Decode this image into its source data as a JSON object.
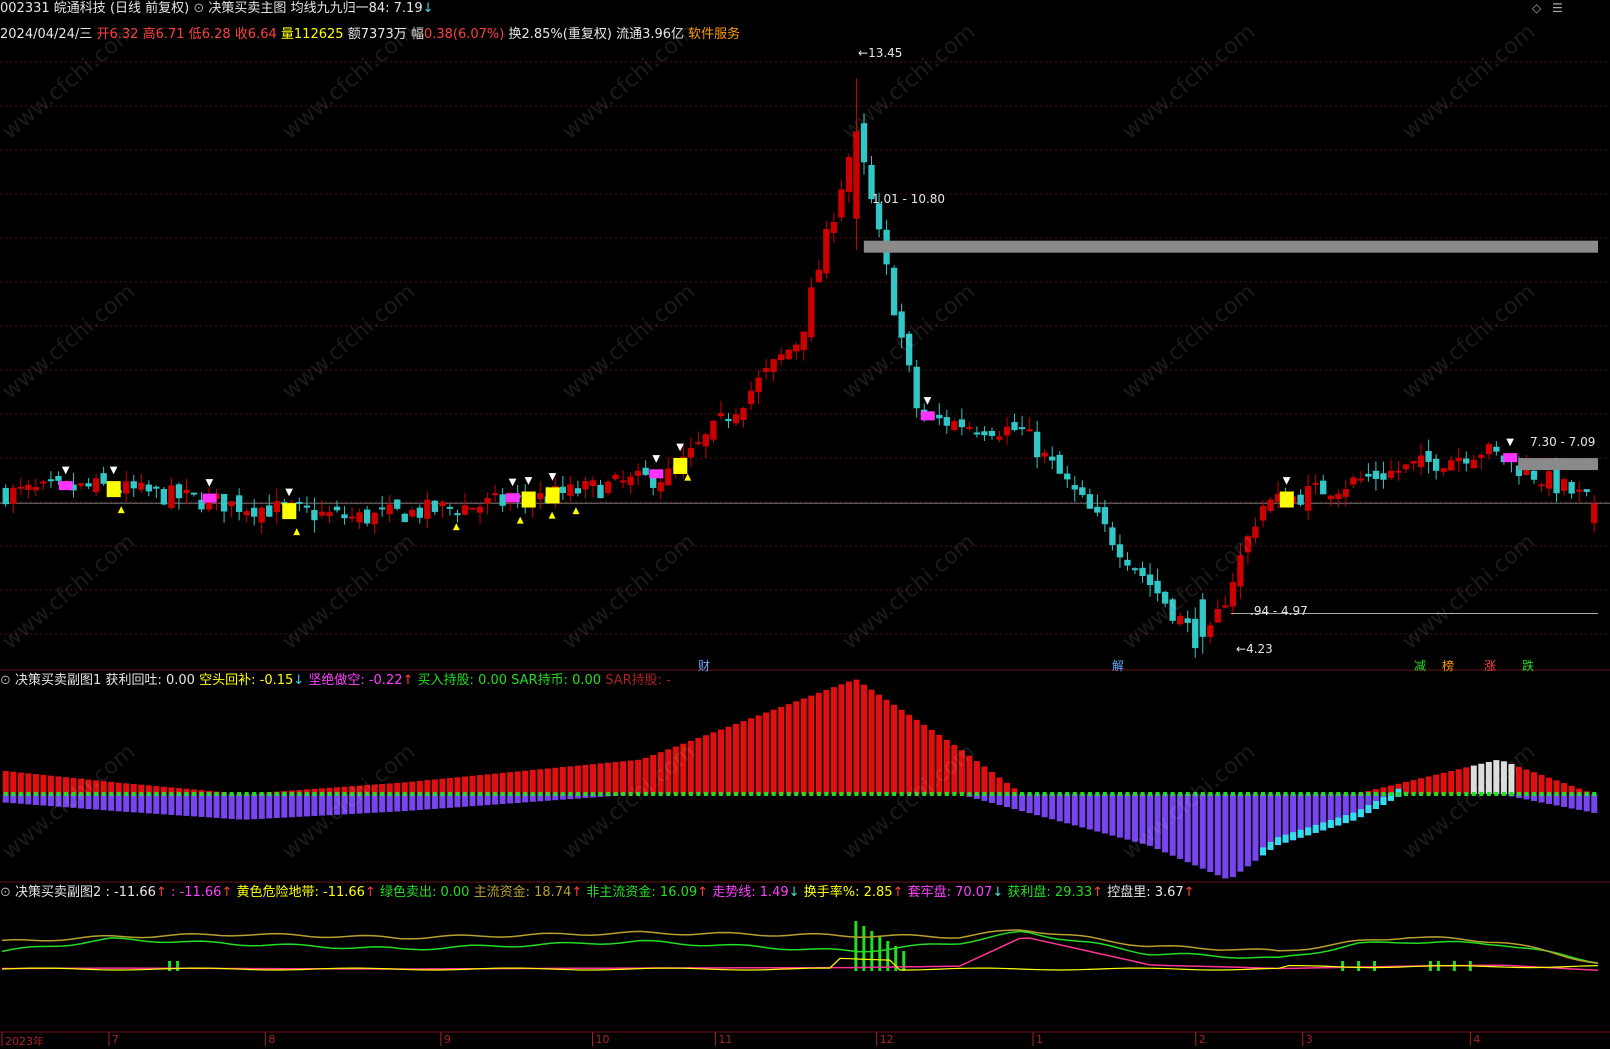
{
  "header": {
    "code": "002331",
    "name": "皖通科技",
    "period": "(日线 前复权)",
    "main_title": "决策买卖主图",
    "ma_label": "均线九九归一84:",
    "ma_value": "7.19",
    "ma_arrow": "↓"
  },
  "quote": {
    "date": "2024/04/24/三",
    "open_label": "开",
    "open": "6.32",
    "high_label": "高",
    "high": "6.71",
    "low_label": "低",
    "low": "6.28",
    "close_label": "收",
    "close": "6.64",
    "vol_label": "量",
    "vol": "112625",
    "amt_label": "额",
    "amt": "7373万",
    "chg_label": "幅",
    "chg": "0.38(6.07%)",
    "turnover": "换2.85%(重复权)",
    "float": "流通3.96亿",
    "service": "软件服务"
  },
  "annotations": {
    "peak": "13.45",
    "resist": "1.01 - 10.80",
    "support": ".94 - 4.97",
    "low": "4.23",
    "right_zone": "7.30 - 7.09"
  },
  "markers": {
    "cai": "财",
    "jie": "解",
    "jian": "减",
    "bang": "榜",
    "zhang": "涨",
    "die": "跌"
  },
  "panel1": {
    "title": "决策买卖副图1",
    "items": [
      {
        "label": "获利回吐:",
        "value": "0.00",
        "arrow": ""
      },
      {
        "label": "空头回补:",
        "value": "-0.15",
        "arrow": "↓"
      },
      {
        "label": "坚绝做空:",
        "value": "-0.22",
        "arrow": "↑"
      },
      {
        "label": "买入持股:",
        "value": "0.00",
        "arrow": ""
      },
      {
        "label": "SAR持币:",
        "value": "0.00",
        "arrow": ""
      },
      {
        "label": "SAR持股:",
        "value": "-",
        "arrow": ""
      }
    ]
  },
  "panel2": {
    "title": "决策买卖副图2",
    "items": [
      {
        "label": ":",
        "value": "-11.66",
        "arrow": "↑"
      },
      {
        "label": ":",
        "value": "-11.66",
        "arrow": "↑"
      },
      {
        "label": "黄色危险地带:",
        "value": "-11.66",
        "arrow": "↑"
      },
      {
        "label": "绿色卖出:",
        "value": "0.00",
        "arrow": ""
      },
      {
        "label": "主流资金:",
        "value": "18.74",
        "arrow": "↑"
      },
      {
        "label": "非主流资金:",
        "value": "16.09",
        "arrow": "↑"
      },
      {
        "label": "走势线:",
        "value": "1.49",
        "arrow": "↓"
      },
      {
        "label": "换手率%:",
        "value": "2.85",
        "arrow": "↑"
      },
      {
        "label": "套牢盘:",
        "value": "70.07",
        "arrow": "↓"
      },
      {
        "label": "获利盘:",
        "value": "29.33",
        "arrow": "↑"
      },
      {
        "label": "控盘里:",
        "value": "3.67",
        "arrow": "↑"
      }
    ]
  },
  "watermark": "www.cfchi.com",
  "colors": {
    "up": "#cc0000",
    "down": "#33c6c6",
    "yellow": "#ffff00",
    "magenta": "#ff33ff",
    "band": "#8a8a8a",
    "grid": "#5a1010",
    "purple": "#7744ee",
    "green": "#22dd22"
  },
  "chart_data": [
    {
      "type": "candlestick",
      "title": "决策买卖主图",
      "x_ticks": [
        "2023年",
        "7",
        "8",
        "9",
        "10",
        "11",
        "12",
        "1",
        "2",
        "3",
        "4"
      ],
      "ylim": [
        4.0,
        14.0
      ],
      "peak": 13.45,
      "low": 4.23,
      "key_levels": [
        10.8,
        7.3,
        7.09,
        4.97
      ],
      "last": {
        "date": "2024/04/24",
        "open": 6.32,
        "high": 6.71,
        "low": 6.28,
        "close": 6.64
      },
      "close_path": [
        {
          "x": "2023-06",
          "y": 6.8
        },
        {
          "x": "2023-07",
          "y": 6.9
        },
        {
          "x": "2023-08",
          "y": 6.6
        },
        {
          "x": "2023-09",
          "y": 6.4
        },
        {
          "x": "2023-10",
          "y": 6.7
        },
        {
          "x": "2023-11",
          "y": 7.1
        },
        {
          "x": "2023-11-late",
          "y": 9.3
        },
        {
          "x": "2023-12-01",
          "y": 12.6
        },
        {
          "x": "2023-12-mid",
          "y": 8.0
        },
        {
          "x": "2024-01",
          "y": 7.8
        },
        {
          "x": "2024-02-05",
          "y": 4.3
        },
        {
          "x": "2024-02-20",
          "y": 6.6
        },
        {
          "x": "2024-03",
          "y": 7.0
        },
        {
          "x": "2024-04-10",
          "y": 7.5
        },
        {
          "x": "2024-04-24",
          "y": 6.64
        }
      ]
    },
    {
      "type": "bar",
      "title": "决策买卖副图1",
      "series": [
        {
          "name": "获利回吐",
          "values": [
            0.2,
            0.1,
            0.0,
            0.1,
            0.3,
            1.0,
            0.4,
            0.0,
            0.0,
            0.0,
            0.0,
            0.0,
            0.1,
            0.3,
            0.0
          ]
        },
        {
          "name": "坚绝做空",
          "values": [
            -0.1,
            -0.2,
            -0.3,
            -0.2,
            0.0,
            0.0,
            0.0,
            -0.2,
            -0.6,
            -1.0,
            -0.6,
            -0.3,
            0.0,
            0.0,
            -0.22
          ]
        }
      ],
      "ylim": [
        -1.1,
        1.1
      ]
    },
    {
      "type": "line",
      "title": "决策买卖副图2",
      "series": [
        {
          "name": "主流资金",
          "values": [
            40,
            65,
            55,
            45,
            60,
            40,
            58,
            80,
            35,
            30,
            25,
            55,
            60,
            55,
            18.74
          ]
        },
        {
          "name": "非主流资金",
          "values": [
            60,
            70,
            75,
            68,
            78,
            72,
            70,
            85,
            50,
            45,
            40,
            60,
            70,
            60,
            16.09
          ]
        },
        {
          "name": "走势线",
          "values": [
            5,
            6,
            5,
            4,
            6,
            7,
            10,
            70,
            12,
            8,
            5,
            8,
            10,
            12,
            1.49
          ]
        },
        {
          "name": "黄色危险地带",
          "values": [
            -3,
            -4,
            -3,
            -5,
            -4,
            -2,
            -2,
            0,
            -10,
            -12,
            -50,
            -15,
            -5,
            -2,
            -11.66
          ]
        }
      ],
      "ylim": [
        -60,
        100
      ]
    }
  ]
}
